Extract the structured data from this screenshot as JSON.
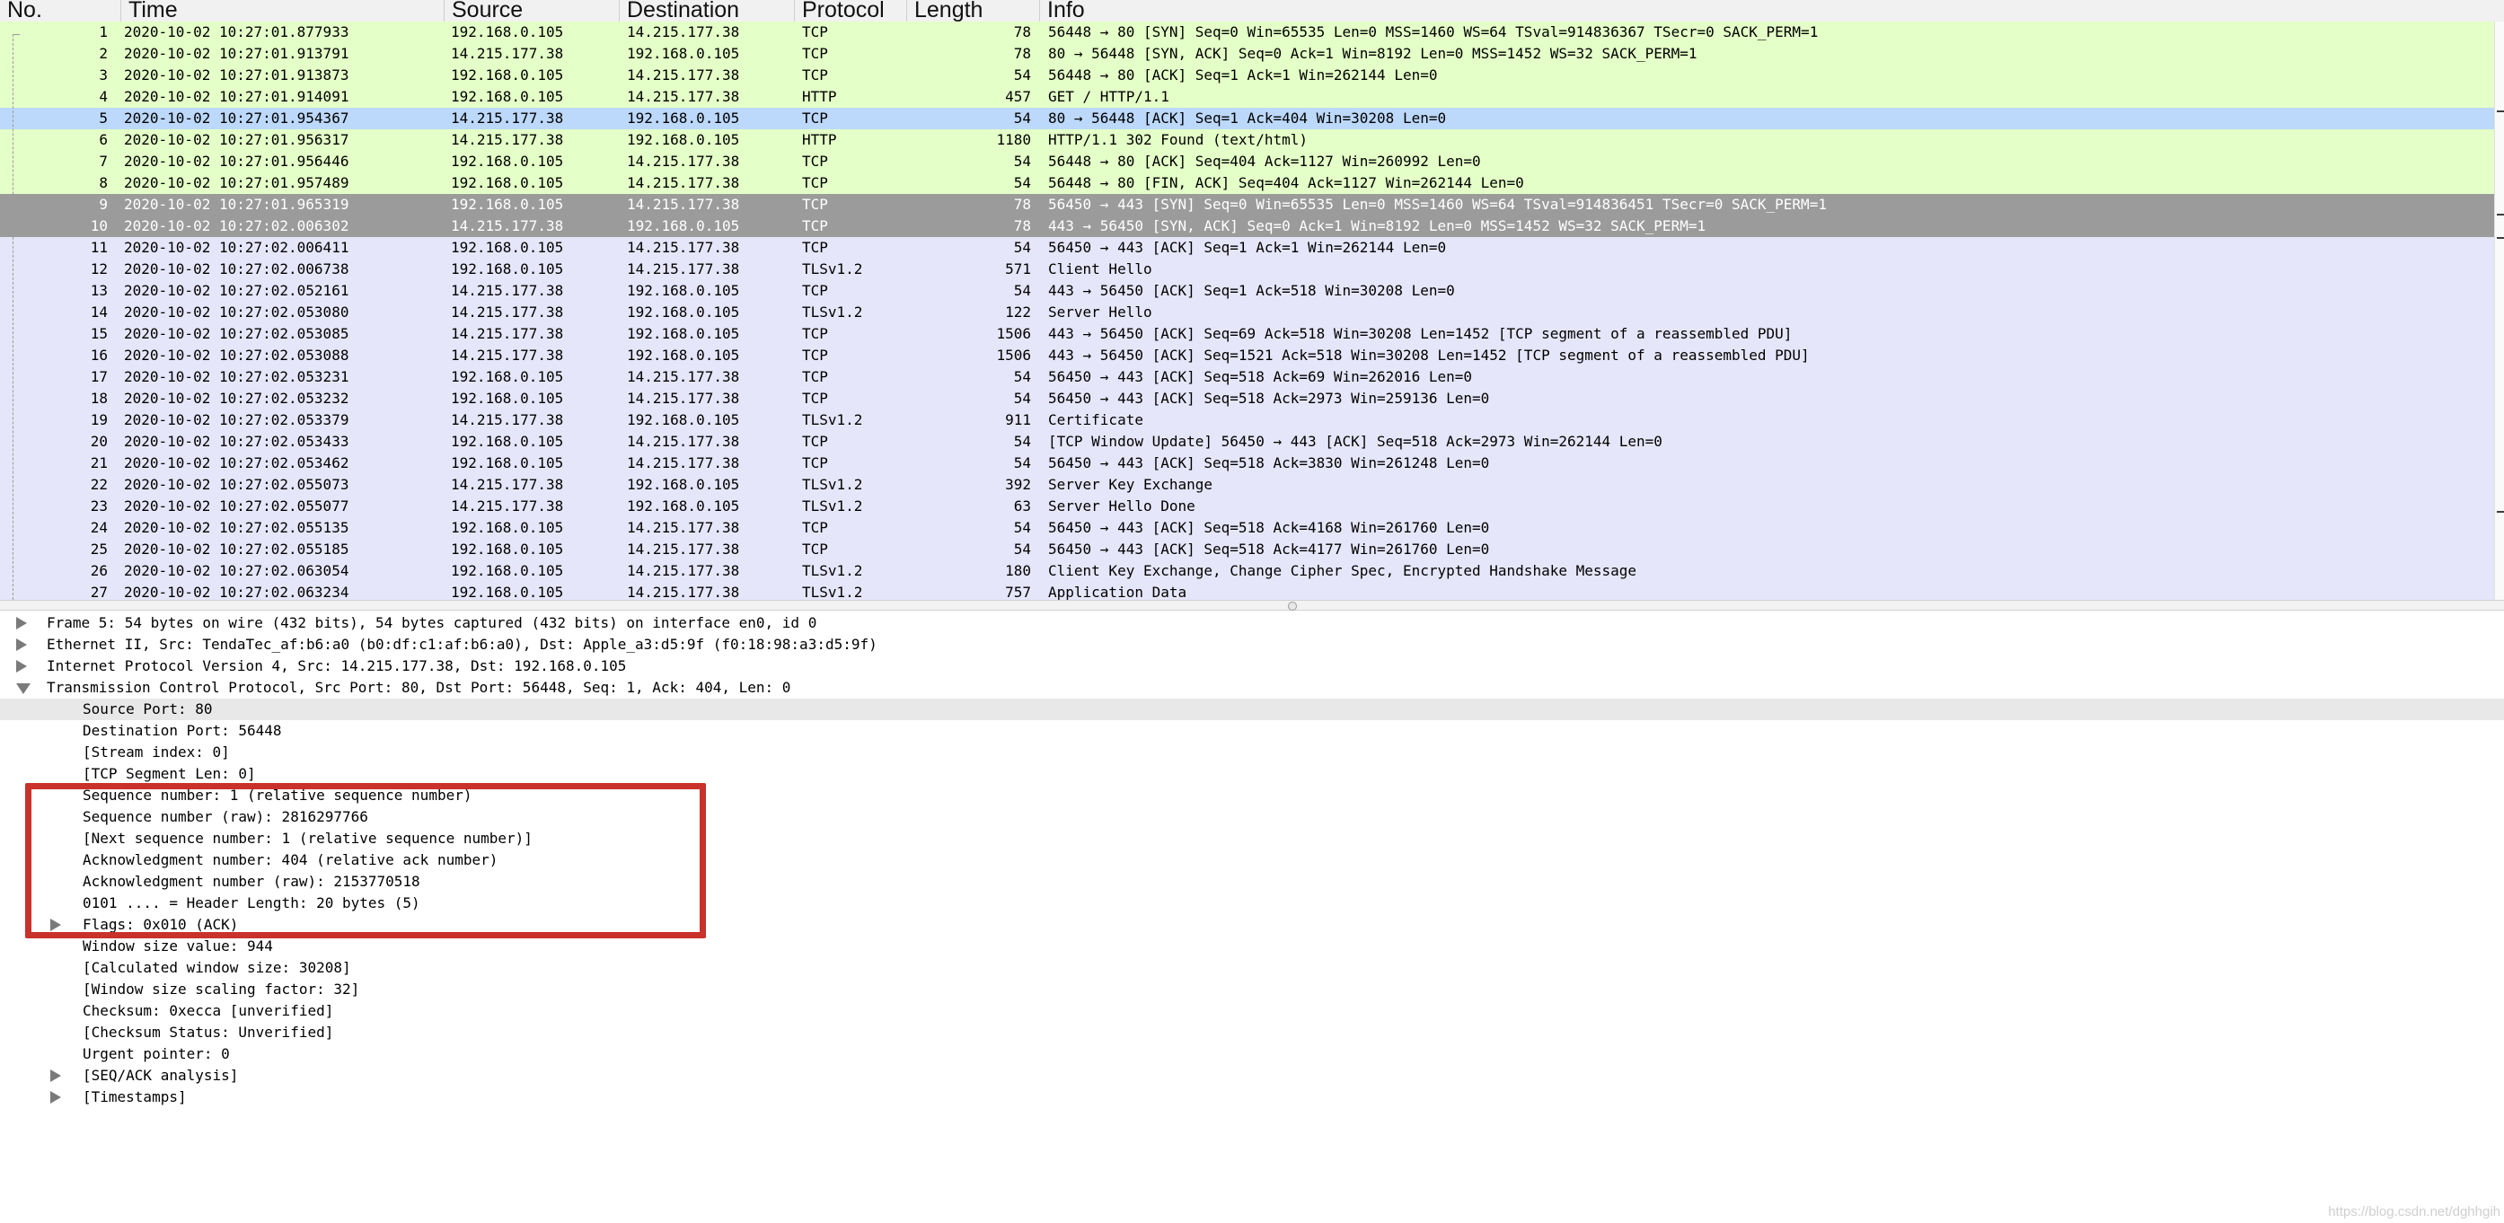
{
  "columns": [
    "No.",
    "Time",
    "Source",
    "Destination",
    "Protocol",
    "Length",
    "Info"
  ],
  "colors": {
    "tcp_green": "#e4ffc7",
    "selected_blue": "#bcd8fa",
    "dark_gray": "#a0a0a0",
    "tls_lavender": "#e6e6fa",
    "highlight_red": "#c9312b"
  },
  "packets": [
    {
      "no": "1",
      "time": "2020-10-02 10:27:01.877933",
      "src": "192.168.0.105",
      "dst": "14.215.177.38",
      "proto": "TCP",
      "len": "78",
      "info": "56448 → 80 [SYN] Seq=0 Win=65535 Len=0 MSS=1460 WS=64 TSval=914836367 TSecr=0 SACK_PERM=1",
      "bg": "#e4ffc7",
      "style": "normal"
    },
    {
      "no": "2",
      "time": "2020-10-02 10:27:01.913791",
      "src": "14.215.177.38",
      "dst": "192.168.0.105",
      "proto": "TCP",
      "len": "78",
      "info": "80 → 56448 [SYN, ACK] Seq=0 Ack=1 Win=8192 Len=0 MSS=1452 WS=32 SACK_PERM=1",
      "bg": "#e4ffc7",
      "style": "normal"
    },
    {
      "no": "3",
      "time": "2020-10-02 10:27:01.913873",
      "src": "192.168.0.105",
      "dst": "14.215.177.38",
      "proto": "TCP",
      "len": "54",
      "info": "56448 → 80 [ACK] Seq=1 Ack=1 Win=262144 Len=0",
      "bg": "#e4ffc7",
      "style": "normal"
    },
    {
      "no": "4",
      "time": "2020-10-02 10:27:01.914091",
      "src": "192.168.0.105",
      "dst": "14.215.177.38",
      "proto": "HTTP",
      "len": "457",
      "info": "GET / HTTP/1.1",
      "bg": "#e4ffc7",
      "style": "normal"
    },
    {
      "no": "5",
      "time": "2020-10-02 10:27:01.954367",
      "src": "14.215.177.38",
      "dst": "192.168.0.105",
      "proto": "TCP",
      "len": "54",
      "info": "80 → 56448 [ACK] Seq=1 Ack=404 Win=30208 Len=0",
      "bg": "#bcd8fa",
      "style": "sel"
    },
    {
      "no": "6",
      "time": "2020-10-02 10:27:01.956317",
      "src": "14.215.177.38",
      "dst": "192.168.0.105",
      "proto": "HTTP",
      "len": "1180",
      "info": "HTTP/1.1 302 Found  (text/html)",
      "bg": "#e4ffc7",
      "style": "normal"
    },
    {
      "no": "7",
      "time": "2020-10-02 10:27:01.956446",
      "src": "192.168.0.105",
      "dst": "14.215.177.38",
      "proto": "TCP",
      "len": "54",
      "info": "56448 → 80 [ACK] Seq=404 Ack=1127 Win=260992 Len=0",
      "bg": "#e4ffc7",
      "style": "normal"
    },
    {
      "no": "8",
      "time": "2020-10-02 10:27:01.957489",
      "src": "192.168.0.105",
      "dst": "14.215.177.38",
      "proto": "TCP",
      "len": "54",
      "info": "56448 → 80 [FIN, ACK] Seq=404 Ack=1127 Win=262144 Len=0",
      "bg": "#e4ffc7",
      "style": "normal"
    },
    {
      "no": "9",
      "time": "2020-10-02 10:27:01.965319",
      "src": "192.168.0.105",
      "dst": "14.215.177.38",
      "proto": "TCP",
      "len": "78",
      "info": "56450 → 443 [SYN] Seq=0 Win=65535 Len=0 MSS=1460 WS=64 TSval=914836451 TSecr=0 SACK_PERM=1",
      "bg": "#a0a0a0",
      "style": "dark"
    },
    {
      "no": "10",
      "time": "2020-10-02 10:27:02.006302",
      "src": "14.215.177.38",
      "dst": "192.168.0.105",
      "proto": "TCP",
      "len": "78",
      "info": "443 → 56450 [SYN, ACK] Seq=0 Ack=1 Win=8192 Len=0 MSS=1452 WS=32 SACK_PERM=1",
      "bg": "#a0a0a0",
      "style": "dark"
    },
    {
      "no": "11",
      "time": "2020-10-02 10:27:02.006411",
      "src": "192.168.0.105",
      "dst": "14.215.177.38",
      "proto": "TCP",
      "len": "54",
      "info": "56450 → 443 [ACK] Seq=1 Ack=1 Win=262144 Len=0",
      "bg": "#e6e6fa",
      "style": "normal"
    },
    {
      "no": "12",
      "time": "2020-10-02 10:27:02.006738",
      "src": "192.168.0.105",
      "dst": "14.215.177.38",
      "proto": "TLSv1.2",
      "len": "571",
      "info": "Client Hello",
      "bg": "#e6e6fa",
      "style": "normal"
    },
    {
      "no": "13",
      "time": "2020-10-02 10:27:02.052161",
      "src": "14.215.177.38",
      "dst": "192.168.0.105",
      "proto": "TCP",
      "len": "54",
      "info": "443 → 56450 [ACK] Seq=1 Ack=518 Win=30208 Len=0",
      "bg": "#e6e6fa",
      "style": "normal"
    },
    {
      "no": "14",
      "time": "2020-10-02 10:27:02.053080",
      "src": "14.215.177.38",
      "dst": "192.168.0.105",
      "proto": "TLSv1.2",
      "len": "122",
      "info": "Server Hello",
      "bg": "#e6e6fa",
      "style": "normal"
    },
    {
      "no": "15",
      "time": "2020-10-02 10:27:02.053085",
      "src": "14.215.177.38",
      "dst": "192.168.0.105",
      "proto": "TCP",
      "len": "1506",
      "info": "443 → 56450 [ACK] Seq=69 Ack=518 Win=30208 Len=1452 [TCP segment of a reassembled PDU]",
      "bg": "#e6e6fa",
      "style": "normal"
    },
    {
      "no": "16",
      "time": "2020-10-02 10:27:02.053088",
      "src": "14.215.177.38",
      "dst": "192.168.0.105",
      "proto": "TCP",
      "len": "1506",
      "info": "443 → 56450 [ACK] Seq=1521 Ack=518 Win=30208 Len=1452 [TCP segment of a reassembled PDU]",
      "bg": "#e6e6fa",
      "style": "normal"
    },
    {
      "no": "17",
      "time": "2020-10-02 10:27:02.053231",
      "src": "192.168.0.105",
      "dst": "14.215.177.38",
      "proto": "TCP",
      "len": "54",
      "info": "56450 → 443 [ACK] Seq=518 Ack=69 Win=262016 Len=0",
      "bg": "#e6e6fa",
      "style": "normal"
    },
    {
      "no": "18",
      "time": "2020-10-02 10:27:02.053232",
      "src": "192.168.0.105",
      "dst": "14.215.177.38",
      "proto": "TCP",
      "len": "54",
      "info": "56450 → 443 [ACK] Seq=518 Ack=2973 Win=259136 Len=0",
      "bg": "#e6e6fa",
      "style": "normal"
    },
    {
      "no": "19",
      "time": "2020-10-02 10:27:02.053379",
      "src": "14.215.177.38",
      "dst": "192.168.0.105",
      "proto": "TLSv1.2",
      "len": "911",
      "info": "Certificate",
      "bg": "#e6e6fa",
      "style": "normal"
    },
    {
      "no": "20",
      "time": "2020-10-02 10:27:02.053433",
      "src": "192.168.0.105",
      "dst": "14.215.177.38",
      "proto": "TCP",
      "len": "54",
      "info": "[TCP Window Update] 56450 → 443 [ACK] Seq=518 Ack=2973 Win=262144 Len=0",
      "bg": "#e6e6fa",
      "style": "normal"
    },
    {
      "no": "21",
      "time": "2020-10-02 10:27:02.053462",
      "src": "192.168.0.105",
      "dst": "14.215.177.38",
      "proto": "TCP",
      "len": "54",
      "info": "56450 → 443 [ACK] Seq=518 Ack=3830 Win=261248 Len=0",
      "bg": "#e6e6fa",
      "style": "normal"
    },
    {
      "no": "22",
      "time": "2020-10-02 10:27:02.055073",
      "src": "14.215.177.38",
      "dst": "192.168.0.105",
      "proto": "TLSv1.2",
      "len": "392",
      "info": "Server Key Exchange",
      "bg": "#e6e6fa",
      "style": "normal"
    },
    {
      "no": "23",
      "time": "2020-10-02 10:27:02.055077",
      "src": "14.215.177.38",
      "dst": "192.168.0.105",
      "proto": "TLSv1.2",
      "len": "63",
      "info": "Server Hello Done",
      "bg": "#e6e6fa",
      "style": "normal"
    },
    {
      "no": "24",
      "time": "2020-10-02 10:27:02.055135",
      "src": "192.168.0.105",
      "dst": "14.215.177.38",
      "proto": "TCP",
      "len": "54",
      "info": "56450 → 443 [ACK] Seq=518 Ack=4168 Win=261760 Len=0",
      "bg": "#e6e6fa",
      "style": "normal"
    },
    {
      "no": "25",
      "time": "2020-10-02 10:27:02.055185",
      "src": "192.168.0.105",
      "dst": "14.215.177.38",
      "proto": "TCP",
      "len": "54",
      "info": "56450 → 443 [ACK] Seq=518 Ack=4177 Win=261760 Len=0",
      "bg": "#e6e6fa",
      "style": "normal"
    },
    {
      "no": "26",
      "time": "2020-10-02 10:27:02.063054",
      "src": "192.168.0.105",
      "dst": "14.215.177.38",
      "proto": "TLSv1.2",
      "len": "180",
      "info": "Client Key Exchange, Change Cipher Spec, Encrypted Handshake Message",
      "bg": "#e6e6fa",
      "style": "normal"
    },
    {
      "no": "27",
      "time": "2020-10-02 10:27:02.063234",
      "src": "192.168.0.105",
      "dst": "14.215.177.38",
      "proto": "TLSv1.2",
      "len": "757",
      "info": "Application Data",
      "bg": "#e6e6fa",
      "style": "normal"
    }
  ],
  "details": [
    {
      "text": "Frame 5: 54 bytes on wire (432 bits), 54 bytes captured (432 bits) on interface en0, id 0",
      "level": 0,
      "expander": "right"
    },
    {
      "text": "Ethernet II, Src: TendaTec_af:b6:a0 (b0:df:c1:af:b6:a0), Dst: Apple_a3:d5:9f (f0:18:98:a3:d5:9f)",
      "level": 0,
      "expander": "right"
    },
    {
      "text": "Internet Protocol Version 4, Src: 14.215.177.38, Dst: 192.168.0.105",
      "level": 0,
      "expander": "right"
    },
    {
      "text": "Transmission Control Protocol, Src Port: 80, Dst Port: 56448, Seq: 1, Ack: 404, Len: 0",
      "level": 0,
      "expander": "down"
    },
    {
      "text": "Source Port: 80",
      "level": 1,
      "expander": "",
      "selected": true
    },
    {
      "text": "Destination Port: 56448",
      "level": 1,
      "expander": ""
    },
    {
      "text": "[Stream index: 0]",
      "level": 1,
      "expander": ""
    },
    {
      "text": "[TCP Segment Len: 0]",
      "level": 1,
      "expander": ""
    },
    {
      "text": "Sequence number: 1    (relative sequence number)",
      "level": 1,
      "expander": ""
    },
    {
      "text": "Sequence number (raw): 2816297766",
      "level": 1,
      "expander": ""
    },
    {
      "text": "[Next sequence number: 1    (relative sequence number)]",
      "level": 1,
      "expander": ""
    },
    {
      "text": "Acknowledgment number: 404    (relative ack number)",
      "level": 1,
      "expander": ""
    },
    {
      "text": "Acknowledgment number (raw): 2153770518",
      "level": 1,
      "expander": ""
    },
    {
      "text": "0101 .... = Header Length: 20 bytes (5)",
      "level": 1,
      "expander": ""
    },
    {
      "text": "Flags: 0x010 (ACK)",
      "level": 1,
      "expander": "right"
    },
    {
      "text": "Window size value: 944",
      "level": 1,
      "expander": ""
    },
    {
      "text": "[Calculated window size: 30208]",
      "level": 1,
      "expander": ""
    },
    {
      "text": "[Window size scaling factor: 32]",
      "level": 1,
      "expander": ""
    },
    {
      "text": "Checksum: 0xecca [unverified]",
      "level": 1,
      "expander": ""
    },
    {
      "text": "[Checksum Status: Unverified]",
      "level": 1,
      "expander": ""
    },
    {
      "text": "Urgent pointer: 0",
      "level": 1,
      "expander": ""
    },
    {
      "text": "[SEQ/ACK analysis]",
      "level": 1,
      "expander": "right"
    },
    {
      "text": "[Timestamps]",
      "level": 1,
      "expander": "right"
    }
  ],
  "watermark": "https://blog.csdn.net/dghhgih"
}
